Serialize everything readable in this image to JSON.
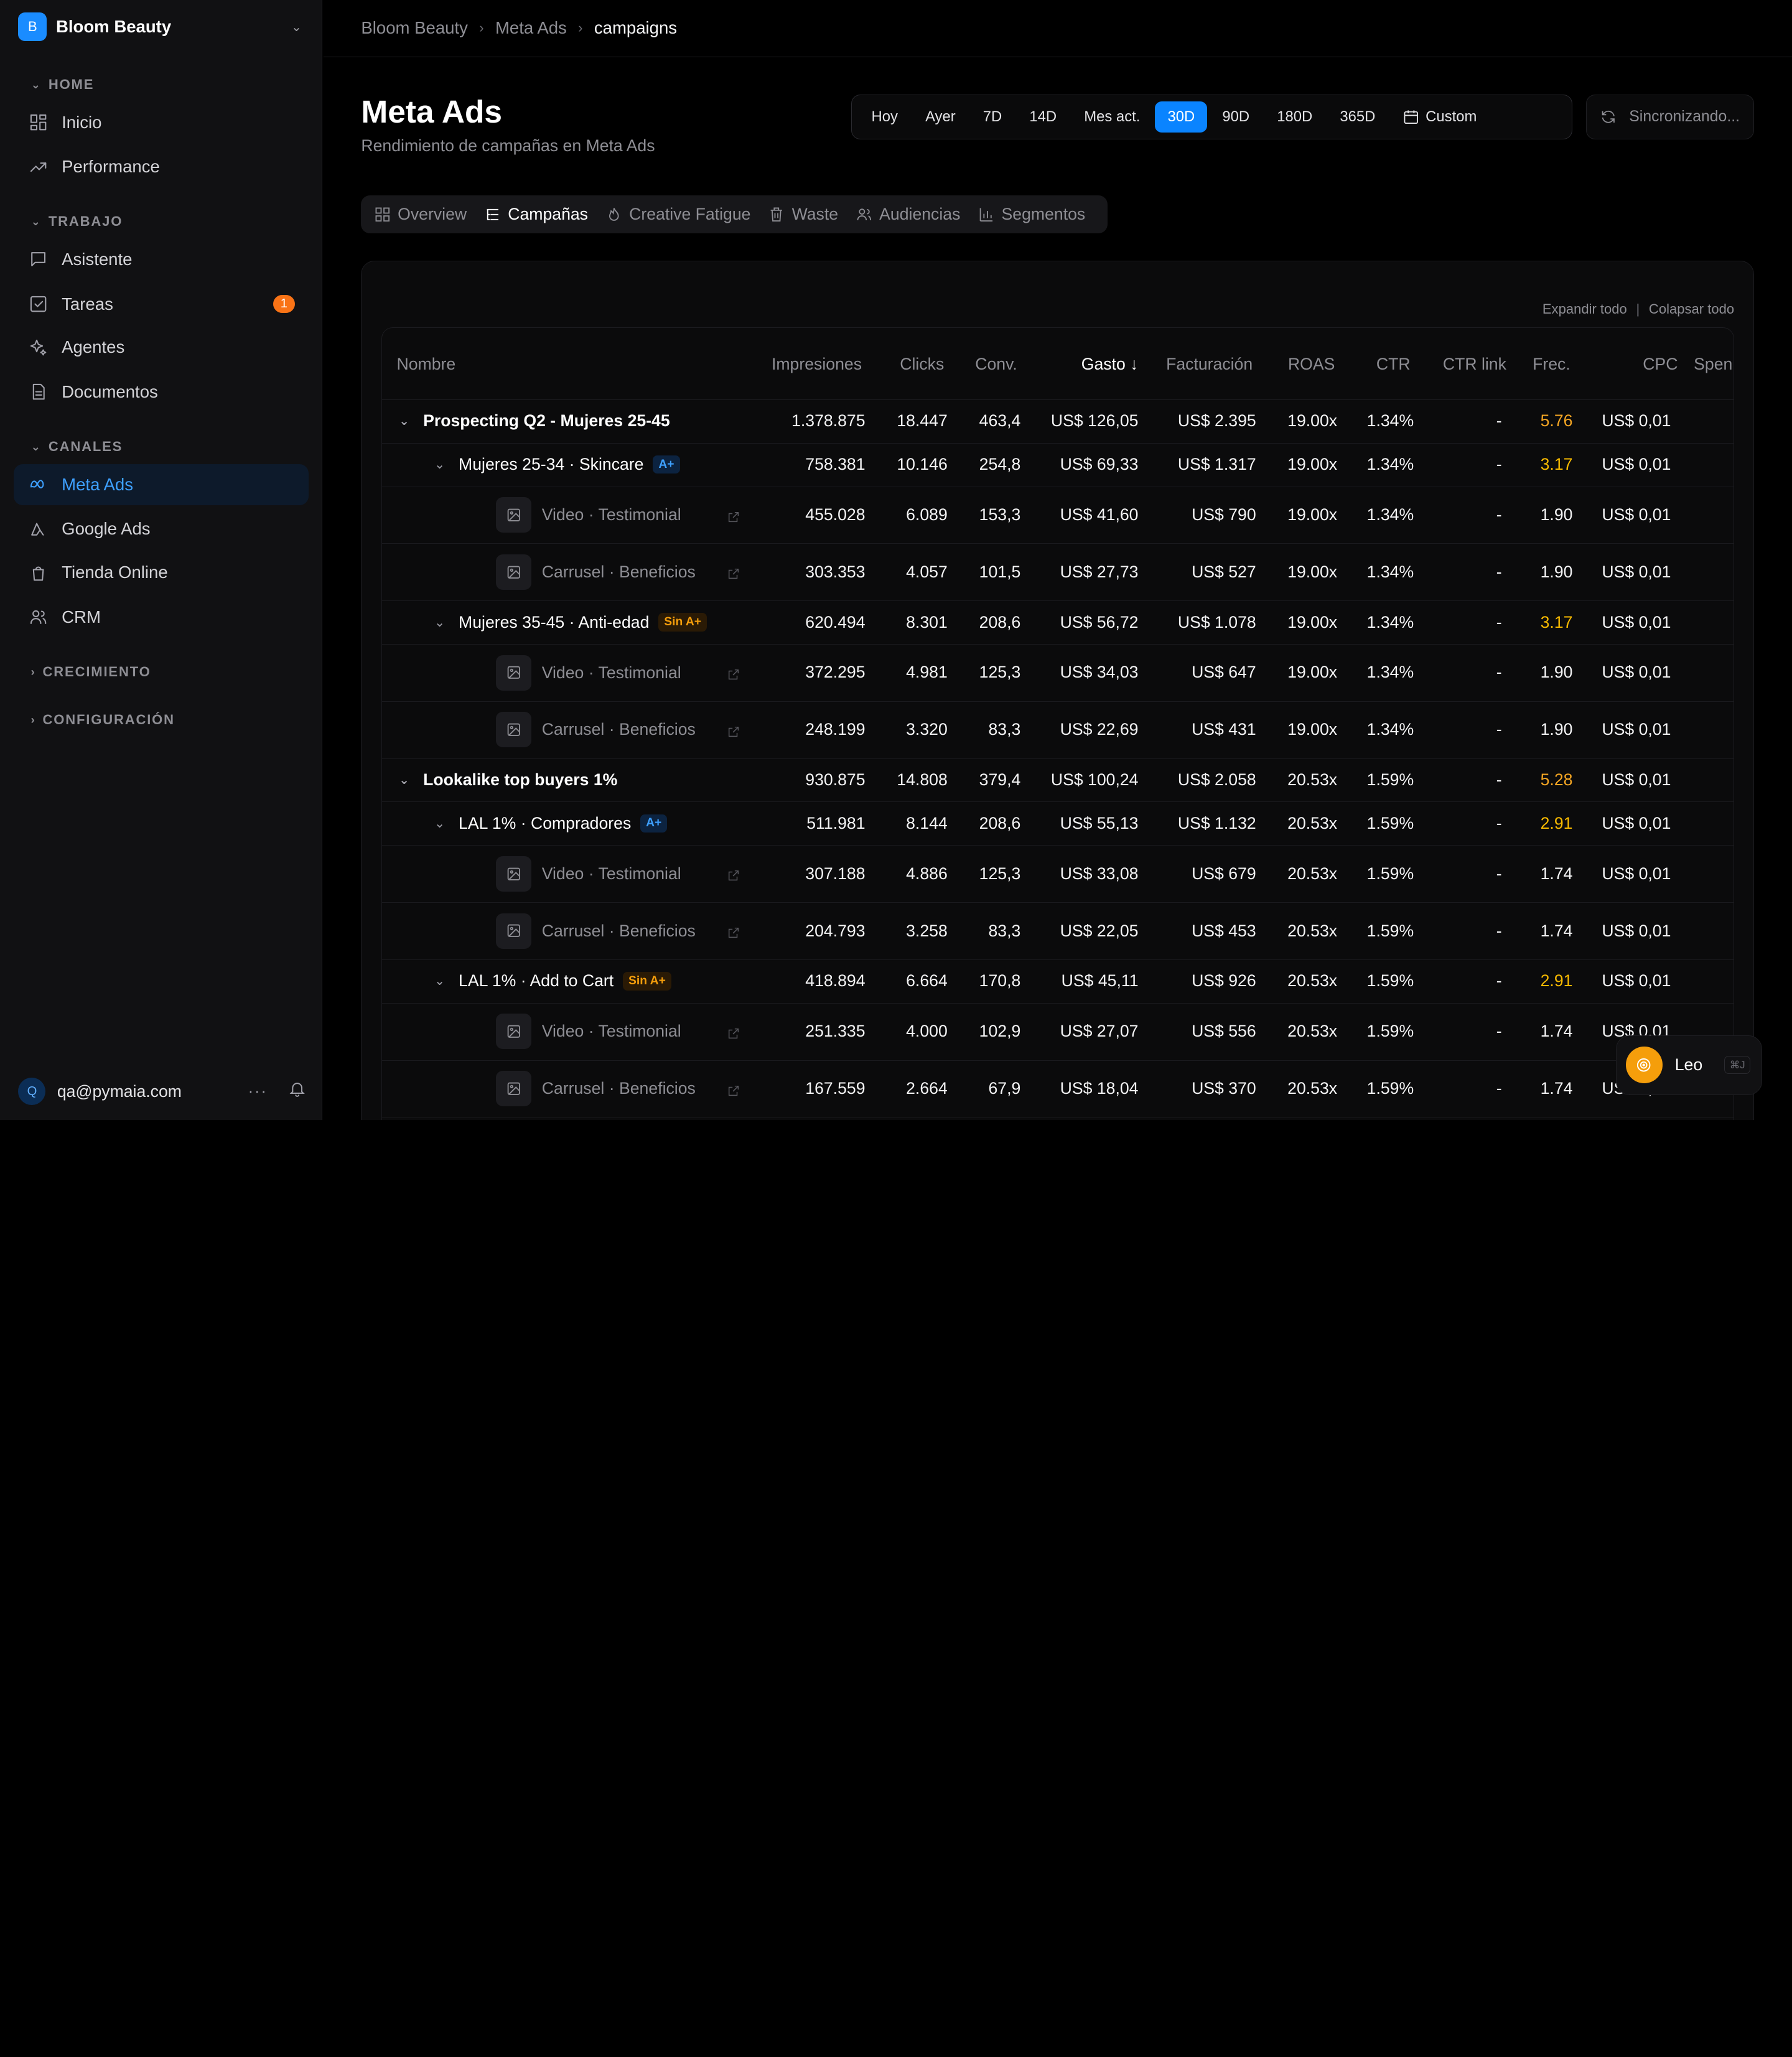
{
  "brand": {
    "initial": "B",
    "name": "Bloom Beauty"
  },
  "sidebar": {
    "sections": {
      "home": "HOME",
      "trabajo": "TRABAJO",
      "canales": "CANALES",
      "crecimiento": "CRECIMIENTO",
      "configuracion": "CONFIGURACIÓN"
    },
    "items": {
      "inicio": "Inicio",
      "performance": "Performance",
      "asistente": "Asistente",
      "tareas": "Tareas",
      "tareas_badge": "1",
      "agentes": "Agentes",
      "documentos": "Documentos",
      "meta_ads": "Meta Ads",
      "google_ads": "Google Ads",
      "tienda_online": "Tienda Online",
      "crm": "CRM"
    },
    "user": {
      "initial": "Q",
      "email": "qa@pymaia.com"
    }
  },
  "breadcrumb": [
    "Bloom Beauty",
    "Meta Ads",
    "campaigns"
  ],
  "header": {
    "title": "Meta Ads",
    "subtitle": "Rendimiento de campañas en Meta Ads",
    "ranges": [
      "Hoy",
      "Ayer",
      "7D",
      "14D",
      "Mes act.",
      "30D",
      "90D",
      "180D",
      "365D"
    ],
    "active_range": "30D",
    "custom_label": "Custom",
    "sync_label": "Sincronizando..."
  },
  "tabs": [
    "Overview",
    "Campañas",
    "Creative Fatigue",
    "Waste",
    "Audiencias",
    "Segmentos"
  ],
  "active_tab": "Campañas",
  "table": {
    "expand_all": "Expandir todo",
    "collapse_all": "Colapsar todo",
    "columns": [
      "Nombre",
      "Impresiones",
      "Clicks",
      "Conv.",
      "Gasto",
      "Facturación",
      "ROAS",
      "CTR",
      "CTR link",
      "Frec.",
      "CPC",
      "Spen"
    ],
    "sorted_column": "Gasto",
    "rows": [
      {
        "level": "campaign",
        "name": "Prospecting Q2 - Mujeres 25-45",
        "tag": "",
        "imp": "1.378.875",
        "clicks": "18.447",
        "conv": "463,4",
        "gasto": "US$ 126,05",
        "fact": "US$ 2.395",
        "roas": "19.00x",
        "ctr": "1.34%",
        "ctrlink": "-",
        "frec": "5.76",
        "cpc": "US$ 0,01"
      },
      {
        "level": "adset",
        "name": "Mujeres 25-34 · Skincare",
        "tag": "A+",
        "imp": "758.381",
        "clicks": "10.146",
        "conv": "254,8",
        "gasto": "US$ 69,33",
        "fact": "US$ 1.317",
        "roas": "19.00x",
        "ctr": "1.34%",
        "ctrlink": "-",
        "frec": "3.17",
        "cpc": "US$ 0,01"
      },
      {
        "level": "ad",
        "name": "Video · Testimonial",
        "tag": "",
        "imp": "455.028",
        "clicks": "6.089",
        "conv": "153,3",
        "gasto": "US$ 41,60",
        "fact": "US$ 790",
        "roas": "19.00x",
        "ctr": "1.34%",
        "ctrlink": "-",
        "frec": "1.90",
        "cpc": "US$ 0,01"
      },
      {
        "level": "ad",
        "name": "Carrusel · Beneficios",
        "tag": "",
        "imp": "303.353",
        "clicks": "4.057",
        "conv": "101,5",
        "gasto": "US$ 27,73",
        "fact": "US$ 527",
        "roas": "19.00x",
        "ctr": "1.34%",
        "ctrlink": "-",
        "frec": "1.90",
        "cpc": "US$ 0,01"
      },
      {
        "level": "adset",
        "name": "Mujeres 35-45 · Anti-edad",
        "tag": "Sin A+",
        "imp": "620.494",
        "clicks": "8.301",
        "conv": "208,6",
        "gasto": "US$ 56,72",
        "fact": "US$ 1.078",
        "roas": "19.00x",
        "ctr": "1.34%",
        "ctrlink": "-",
        "frec": "3.17",
        "cpc": "US$ 0,01"
      },
      {
        "level": "ad",
        "name": "Video · Testimonial",
        "tag": "",
        "imp": "372.295",
        "clicks": "4.981",
        "conv": "125,3",
        "gasto": "US$ 34,03",
        "fact": "US$ 647",
        "roas": "19.00x",
        "ctr": "1.34%",
        "ctrlink": "-",
        "frec": "1.90",
        "cpc": "US$ 0,01"
      },
      {
        "level": "ad",
        "name": "Carrusel · Beneficios",
        "tag": "",
        "imp": "248.199",
        "clicks": "3.320",
        "conv": "83,3",
        "gasto": "US$ 22,69",
        "fact": "US$ 431",
        "roas": "19.00x",
        "ctr": "1.34%",
        "ctrlink": "-",
        "frec": "1.90",
        "cpc": "US$ 0,01"
      },
      {
        "level": "campaign",
        "name": "Lookalike top buyers 1%",
        "tag": "",
        "imp": "930.875",
        "clicks": "14.808",
        "conv": "379,4",
        "gasto": "US$ 100,24",
        "fact": "US$ 2.058",
        "roas": "20.53x",
        "ctr": "1.59%",
        "ctrlink": "-",
        "frec": "5.28",
        "cpc": "US$ 0,01"
      },
      {
        "level": "adset",
        "name": "LAL 1% · Compradores",
        "tag": "A+",
        "imp": "511.981",
        "clicks": "8.144",
        "conv": "208,6",
        "gasto": "US$ 55,13",
        "fact": "US$ 1.132",
        "roas": "20.53x",
        "ctr": "1.59%",
        "ctrlink": "-",
        "frec": "2.91",
        "cpc": "US$ 0,01"
      },
      {
        "level": "ad",
        "name": "Video · Testimonial",
        "tag": "",
        "imp": "307.188",
        "clicks": "4.886",
        "conv": "125,3",
        "gasto": "US$ 33,08",
        "fact": "US$ 679",
        "roas": "20.53x",
        "ctr": "1.59%",
        "ctrlink": "-",
        "frec": "1.74",
        "cpc": "US$ 0,01"
      },
      {
        "level": "ad",
        "name": "Carrusel · Beneficios",
        "tag": "",
        "imp": "204.793",
        "clicks": "3.258",
        "conv": "83,3",
        "gasto": "US$ 22,05",
        "fact": "US$ 453",
        "roas": "20.53x",
        "ctr": "1.59%",
        "ctrlink": "-",
        "frec": "1.74",
        "cpc": "US$ 0,01"
      },
      {
        "level": "adset",
        "name": "LAL 1% · Add to Cart",
        "tag": "Sin A+",
        "imp": "418.894",
        "clicks": "6.664",
        "conv": "170,8",
        "gasto": "US$ 45,11",
        "fact": "US$ 926",
        "roas": "20.53x",
        "ctr": "1.59%",
        "ctrlink": "-",
        "frec": "2.91",
        "cpc": "US$ 0,01"
      },
      {
        "level": "ad",
        "name": "Video · Testimonial",
        "tag": "",
        "imp": "251.335",
        "clicks": "4.000",
        "conv": "102,9",
        "gasto": "US$ 27,07",
        "fact": "US$ 556",
        "roas": "20.53x",
        "ctr": "1.59%",
        "ctrlink": "-",
        "frec": "1.74",
        "cpc": "US$ 0,01"
      },
      {
        "level": "ad",
        "name": "Carrusel · Beneficios",
        "tag": "",
        "imp": "167.559",
        "clicks": "2.664",
        "conv": "67,9",
        "gasto": "US$ 18,04",
        "fact": "US$ 370",
        "roas": "20.53x",
        "ctr": "1.59%",
        "ctrlink": "-",
        "frec": "1.74",
        "cpc": "US$ 0,01"
      }
    ]
  },
  "leo": {
    "name": "Leo",
    "shortcut": "⌘J"
  },
  "colors": {
    "accent": "#0a84ff",
    "active_nav": "#3ea0ff",
    "badge": "#f97316",
    "freq_warning": "#f5a623"
  }
}
